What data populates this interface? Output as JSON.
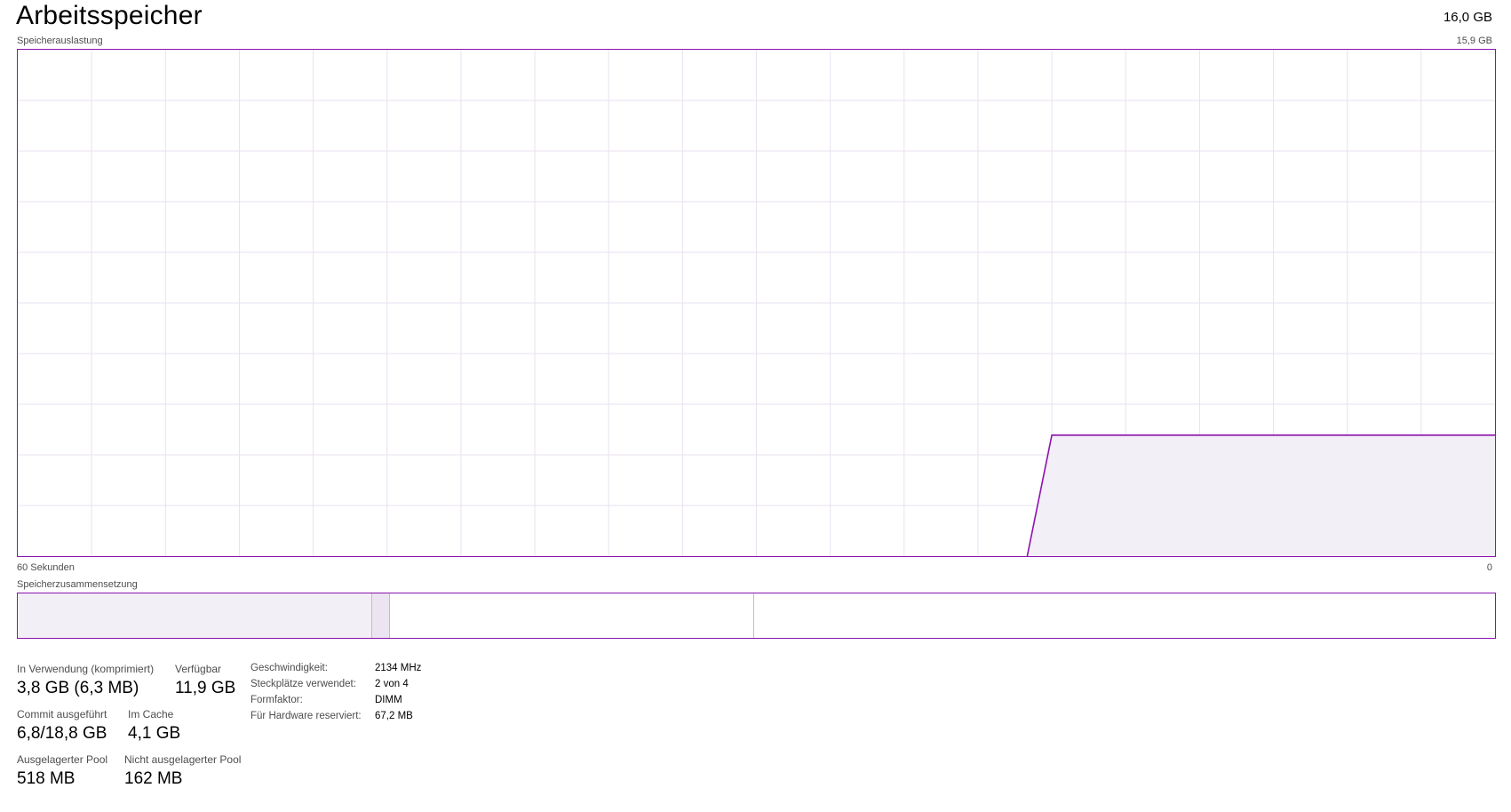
{
  "header": {
    "title": "Arbeitsspeicher",
    "capacity": "16,0 GB"
  },
  "usage_graph": {
    "label": "Speicherauslastung",
    "max_label": "15,9 GB",
    "time_left_label": "60 Sekunden",
    "time_right_label": "0"
  },
  "chart_data": {
    "type": "area",
    "title": "Speicherauslastung",
    "xlabel": "",
    "ylabel": "",
    "x_unit": "seconds ago",
    "x": [
      60,
      59,
      58,
      57,
      56,
      55,
      54,
      53,
      52,
      51,
      50,
      49,
      48,
      47,
      46,
      45,
      44,
      43,
      42,
      41,
      40,
      39,
      38,
      37,
      36,
      35,
      34,
      33,
      32,
      31,
      30,
      29,
      28,
      27,
      26,
      25,
      24,
      23,
      22,
      21,
      20,
      19,
      18,
      17,
      16,
      15,
      14,
      13,
      12,
      11,
      10,
      9,
      8,
      7,
      6,
      5,
      4,
      3,
      2,
      1,
      0
    ],
    "series": [
      {
        "values": [
          null,
          null,
          null,
          null,
          null,
          null,
          null,
          null,
          null,
          null,
          null,
          null,
          null,
          null,
          null,
          null,
          null,
          null,
          null,
          null,
          null,
          null,
          null,
          null,
          null,
          null,
          null,
          null,
          null,
          null,
          null,
          null,
          null,
          null,
          null,
          null,
          null,
          null,
          null,
          null,
          null,
          0,
          3.8,
          3.8,
          3.8,
          3.8,
          3.8,
          3.8,
          3.8,
          3.8,
          3.8,
          3.8,
          3.8,
          3.8,
          3.8,
          3.8,
          3.8,
          3.8,
          3.8,
          3.8,
          3.8
        ]
      }
    ],
    "xlim": [
      60,
      0
    ],
    "ylim": [
      0,
      15.9
    ],
    "grid": true,
    "line_color": "#8b12ae",
    "fill_color": "#f3eff6",
    "grid_color": "#e8e1ef"
  },
  "composition": {
    "label": "Speicherzusammensetzung",
    "segments_gb": {
      "in_use": 3.8,
      "modified": 0.2,
      "standby": 4.1,
      "free": 7.8
    }
  },
  "stats": {
    "in_use_label": "In Verwendung (komprimiert)",
    "in_use_value": "3,8 GB (6,3 MB)",
    "available_label": "Verfügbar",
    "available_value": "11,9 GB",
    "committed_label": "Commit ausgeführt",
    "committed_value": "6,8/18,8 GB",
    "cached_label": "Im Cache",
    "cached_value": "4,1 GB",
    "paged_pool_label": "Ausgelagerter Pool",
    "paged_pool_value": "518 MB",
    "nonpaged_pool_label": "Nicht ausgelagerter Pool",
    "nonpaged_pool_value": "162 MB"
  },
  "properties": [
    {
      "label": "Geschwindigkeit:",
      "value": "2134 MHz"
    },
    {
      "label": "Steckplätze verwendet:",
      "value": "2 von 4"
    },
    {
      "label": "Formfaktor:",
      "value": "DIMM"
    },
    {
      "label": "Für Hardware reserviert:",
      "value": "67,2 MB"
    }
  ],
  "colors": {
    "accent": "#8b12ae",
    "fill": "#f3eff6",
    "grid": "#e8e1ef"
  }
}
